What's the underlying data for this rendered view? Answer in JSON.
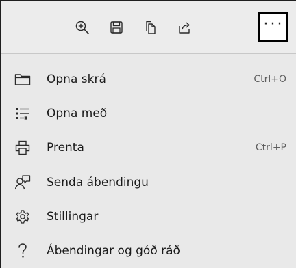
{
  "toolbar": {
    "buttons": [
      {
        "icon": "zoom-in-icon"
      },
      {
        "icon": "save-icon"
      },
      {
        "icon": "copy-icon"
      },
      {
        "icon": "share-icon"
      }
    ],
    "more_label": "···"
  },
  "menu": {
    "items": [
      {
        "label": "Opna skrá",
        "shortcut": "Ctrl+O",
        "icon": "folder-icon"
      },
      {
        "label": "Opna með",
        "shortcut": "",
        "icon": "open-with-icon"
      },
      {
        "label": "Prenta",
        "shortcut": "Ctrl+P",
        "icon": "printer-icon"
      },
      {
        "label": "Senda ábendingu",
        "shortcut": "",
        "icon": "feedback-icon"
      },
      {
        "label": "Stillingar",
        "shortcut": "",
        "icon": "gear-icon"
      },
      {
        "label": "Ábendingar og góð ráð",
        "shortcut": "",
        "icon": "help-icon"
      }
    ]
  },
  "colors": {
    "background": "#e9e9e9",
    "text": "#1b1b1b",
    "shortcut_text": "#5f5f5f",
    "focus_border": "#000000"
  }
}
